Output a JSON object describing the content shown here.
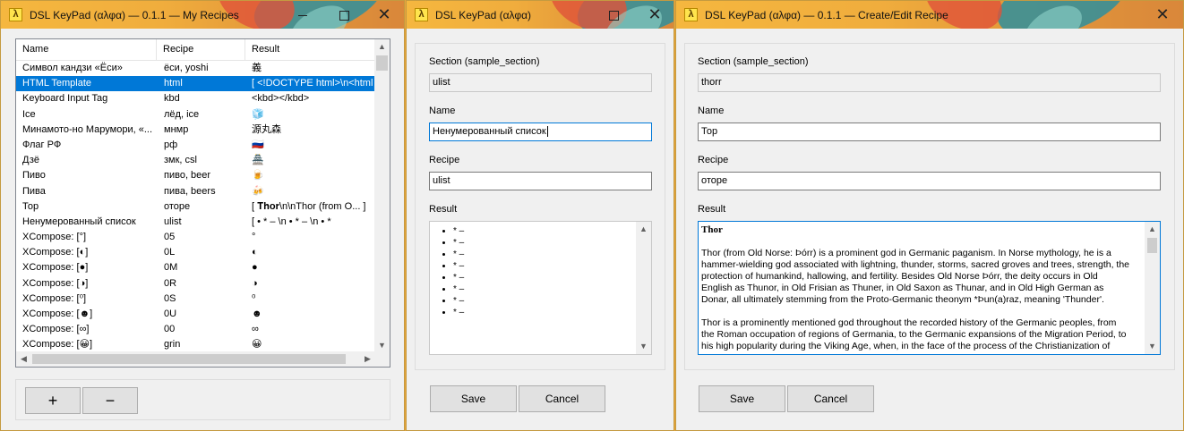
{
  "windows": {
    "list": {
      "title": "DSL KeyPad (αλφα) — 0.1.1 — My Recipes",
      "columns": [
        "Name",
        "Recipe",
        "Result"
      ],
      "rows": [
        {
          "name": "Символ кандзи «Ёси»",
          "recipe": "ёси, yoshi",
          "result": "義"
        },
        {
          "name": "HTML Template",
          "recipe": "html",
          "result": "[ <!DOCTYPE html>\\n<html l...",
          "selected": true
        },
        {
          "name": "Keyboard Input Tag",
          "recipe": "kbd",
          "result": "<kbd></kbd>"
        },
        {
          "name": "Ice",
          "recipe": "лёд, ice",
          "result": "🧊"
        },
        {
          "name": "Минамото-но Марумори, «...",
          "recipe": "мнмр",
          "result": "源丸森"
        },
        {
          "name": "Флаг РФ",
          "recipe": "рф",
          "result": "🇷🇺"
        },
        {
          "name": "Дзё",
          "recipe": "змк, csl",
          "result": "🏯"
        },
        {
          "name": "Пиво",
          "recipe": "пиво, beer",
          "result": "🍺"
        },
        {
          "name": "Пива",
          "recipe": "пива, beers",
          "result": "🍻"
        },
        {
          "name": "Тор",
          "recipe": "оторе",
          "result": "[ 𝐓𝐡𝐨𝐫\\n\\nThor (from O... ]"
        },
        {
          "name": "Ненумерованный список",
          "recipe": "ulist",
          "result": "[   • * – \\n   • * – \\n   • *"
        },
        {
          "name": "XCompose: [°]",
          "recipe": "05",
          "result": "°"
        },
        {
          "name": "XCompose: [◐]",
          "recipe": "0L",
          "result": "◐"
        },
        {
          "name": "XCompose: [●]",
          "recipe": "0M",
          "result": "●"
        },
        {
          "name": "XCompose: [◑]",
          "recipe": "0R",
          "result": "◑"
        },
        {
          "name": "XCompose: [⁰]",
          "recipe": "0S",
          "result": "⁰"
        },
        {
          "name": "XCompose: [☻]",
          "recipe": "0U",
          "result": "☻"
        },
        {
          "name": "XCompose: [∞]",
          "recipe": "00",
          "result": "∞"
        },
        {
          "name": "XCompose: [😀]",
          "recipe": "grin",
          "result": "😀"
        }
      ],
      "add_label": "+",
      "remove_label": "−"
    },
    "edit1": {
      "title": "DSL KeyPad (αλφα)",
      "section_label": "Section (sample_section)",
      "section_value": "ulist",
      "name_label": "Name",
      "name_value": "Ненумерованный список",
      "recipe_label": "Recipe",
      "recipe_value": "ulist",
      "result_label": "Result",
      "result_items": [
        "* –",
        "* –",
        "* –",
        "* –",
        "* –",
        "* –",
        "* –",
        "* –"
      ],
      "save_label": "Save",
      "cancel_label": "Cancel"
    },
    "edit2": {
      "title": "DSL KeyPad (αλφα) — 0.1.1 — Create/Edit Recipe",
      "section_label": "Section (sample_section)",
      "section_value": "thorr",
      "name_label": "Name",
      "name_value": "Тор",
      "recipe_label": "Recipe",
      "recipe_value": "оторе",
      "result_label": "Result",
      "result_heading": "Thor",
      "result_p1": "Thor (from Old Norse: Þórr) is a prominent god in Germanic paganism. In Norse mythology, he is a hammer-wielding god associated with lightning, thunder, storms, sacred groves and trees, strength, the protection of humankind, hallowing, and fertility. Besides Old Norse Þórr, the deity occurs in Old English as Thunor, in Old Frisian as Thuner, in Old Saxon as Thunar, and in Old High German as Donar, all ultimately stemming from the Proto-Germanic theonym *Þun(a)raz, meaning 'Thunder'.",
      "result_p2": "Thor is a prominently mentioned god throughout the recorded history of the Germanic peoples, from the Roman occupation of regions of Germania, to the Germanic expansions of the Migration Period, to his high popularity during the Viking Age, when, in the face of the process of the Christianization of",
      "save_label": "Save",
      "cancel_label": "Cancel"
    }
  }
}
